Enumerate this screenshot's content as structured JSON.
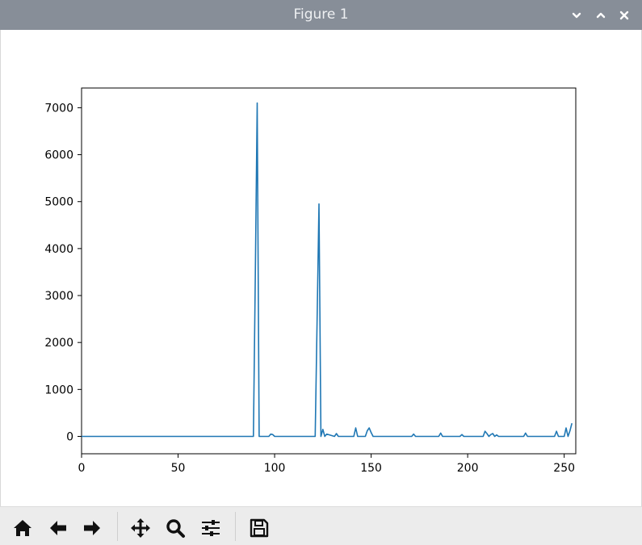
{
  "window": {
    "title": "Figure 1",
    "titlebar_color": "#878e98",
    "controls": [
      "chevron-down-icon",
      "chevron-up-icon",
      "close-icon"
    ]
  },
  "toolbar": {
    "tools": [
      "home-icon",
      "back-arrow-icon",
      "forward-arrow-icon",
      "pan-icon",
      "zoom-icon",
      "configure-subplots-icon",
      "save-icon"
    ]
  },
  "chart_data": {
    "type": "line",
    "title": "",
    "xlabel": "",
    "ylabel": "",
    "xlim": [
      0,
      256
    ],
    "ylim": [
      -370,
      7420
    ],
    "xticks": [
      0,
      50,
      100,
      150,
      200,
      250
    ],
    "yticks": [
      0,
      1000,
      2000,
      3000,
      4000,
      5000,
      6000,
      7000
    ],
    "grid": false,
    "line_color": "#1f77b4",
    "series": [
      {
        "x": [
          0,
          89,
          90,
          91,
          92,
          97,
          98,
          99,
          100,
          121,
          122,
          123,
          124,
          125,
          126,
          127,
          131,
          132,
          133,
          141,
          142,
          143,
          147,
          148,
          149,
          150,
          151,
          171,
          172,
          173,
          185,
          186,
          187,
          196,
          197,
          198,
          208,
          209,
          210,
          211,
          212,
          213,
          214,
          215,
          216,
          217,
          218,
          229,
          230,
          231,
          245,
          246,
          247,
          250,
          251,
          252,
          253,
          254
        ],
        "y": [
          0,
          0,
          3500,
          7100,
          0,
          0,
          50,
          40,
          0,
          0,
          2500,
          4950,
          0,
          150,
          0,
          50,
          0,
          60,
          0,
          0,
          180,
          0,
          0,
          120,
          180,
          80,
          0,
          0,
          50,
          0,
          0,
          70,
          0,
          0,
          40,
          0,
          0,
          110,
          60,
          0,
          40,
          60,
          0,
          30,
          0,
          0,
          0,
          0,
          70,
          0,
          0,
          110,
          0,
          0,
          180,
          0,
          120,
          280
        ]
      }
    ]
  }
}
